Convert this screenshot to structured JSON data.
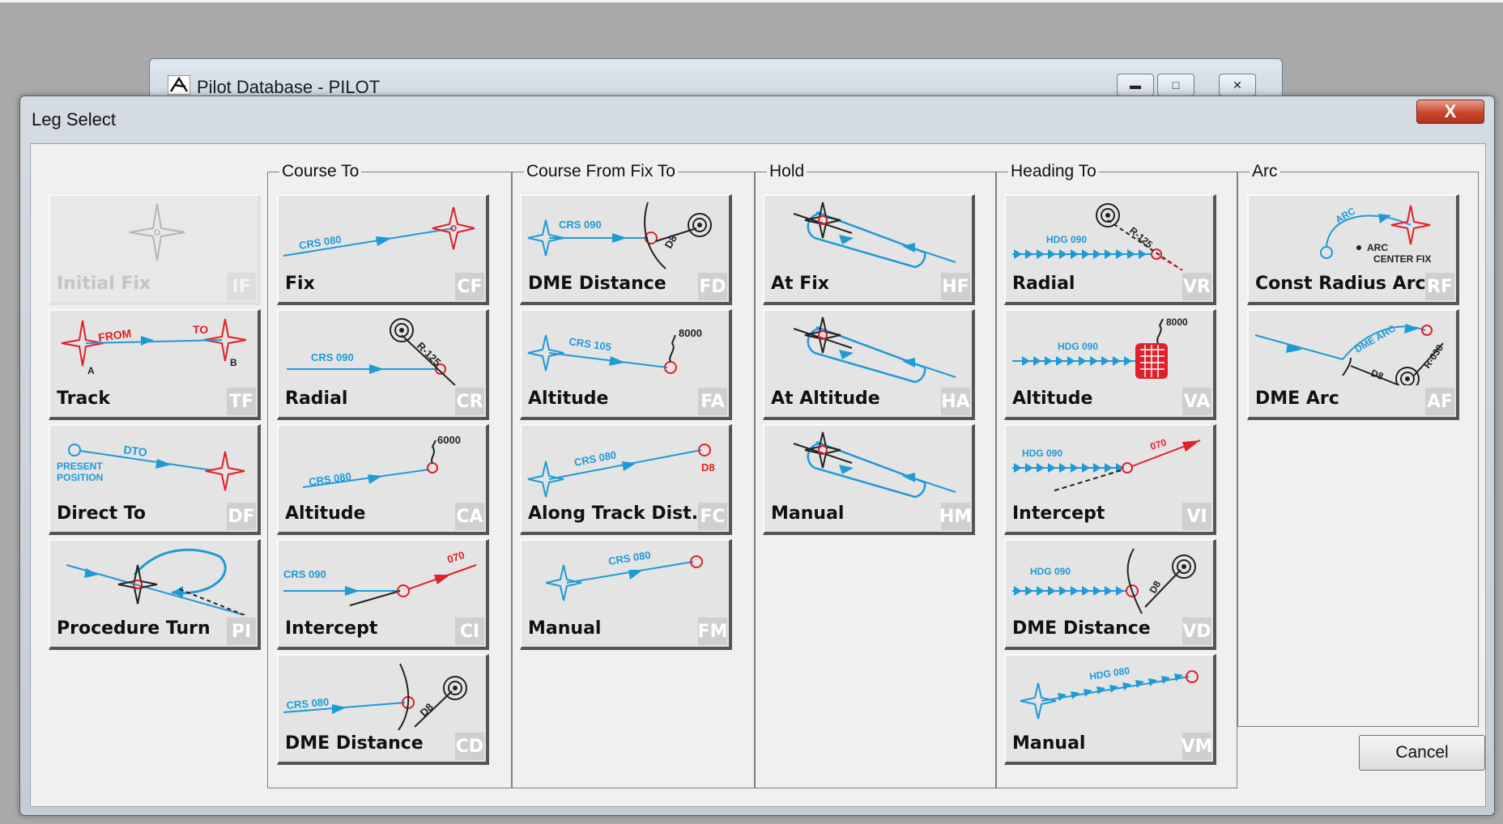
{
  "background_window": {
    "title": "Pilot Database - PILOT"
  },
  "dialog": {
    "title": "Leg Select",
    "close_label": "X",
    "cancel_label": "Cancel"
  },
  "groups": {
    "course_to": "Course To",
    "course_from_fix_to": "Course From Fix To",
    "hold": "Hold",
    "heading_to": "Heading To",
    "arc": "Arc"
  },
  "legs": {
    "if": {
      "label": "Initial Fix",
      "code": "IF",
      "enabled": false
    },
    "tf": {
      "label": "Track",
      "code": "TF",
      "diagram": {
        "from": "FROM",
        "to": "TO",
        "a": "A",
        "b": "B"
      }
    },
    "df": {
      "label": "Direct To",
      "code": "DF",
      "diagram": {
        "dto": "DTO",
        "present": "PRESENT",
        "position": "POSITION"
      }
    },
    "pi": {
      "label": "Procedure Turn",
      "code": "PI"
    },
    "cf": {
      "label": "Fix",
      "code": "CF",
      "diagram": {
        "crs": "CRS 080"
      }
    },
    "cr": {
      "label": "Radial",
      "code": "CR",
      "diagram": {
        "crs": "CRS 090",
        "radial": "R-125"
      }
    },
    "ca": {
      "label": "Altitude",
      "code": "CA",
      "diagram": {
        "crs": "CRS 080",
        "alt": "6000"
      }
    },
    "ci": {
      "label": "Intercept",
      "code": "CI",
      "diagram": {
        "crs": "CRS 090",
        "crs2": "070"
      }
    },
    "cd": {
      "label": "DME Distance",
      "code": "CD",
      "diagram": {
        "crs": "CRS 080",
        "dist": "D8"
      }
    },
    "fd": {
      "label": "DME Distance",
      "code": "FD",
      "diagram": {
        "crs": "CRS 090",
        "dist": "D8"
      }
    },
    "fa": {
      "label": "Altitude",
      "code": "FA",
      "diagram": {
        "crs": "CRS 105",
        "alt": "8000"
      }
    },
    "fc": {
      "label": "Along Track Dist.",
      "code": "FC",
      "diagram": {
        "crs": "CRS 080",
        "dist": "D8"
      }
    },
    "fm": {
      "label": "Manual",
      "code": "FM",
      "diagram": {
        "crs": "CRS 080"
      }
    },
    "hf": {
      "label": "At Fix",
      "code": "HF"
    },
    "ha": {
      "label": "At Altitude",
      "code": "HA"
    },
    "hm": {
      "label": "Manual",
      "code": "HM"
    },
    "vr": {
      "label": "Radial",
      "code": "VR",
      "diagram": {
        "hdg": "HDG 090",
        "radial": "R-125"
      }
    },
    "va": {
      "label": "Altitude",
      "code": "VA",
      "diagram": {
        "hdg": "HDG 090",
        "alt": "8000"
      }
    },
    "vi": {
      "label": "Intercept",
      "code": "VI",
      "diagram": {
        "hdg": "HDG 090",
        "crs2": "070"
      }
    },
    "vd": {
      "label": "DME Distance",
      "code": "VD",
      "diagram": {
        "hdg": "HDG 090",
        "dist": "D8"
      }
    },
    "vm": {
      "label": "Manual",
      "code": "VM",
      "diagram": {
        "hdg": "HDG 080"
      }
    },
    "rf": {
      "label": "Const Radius Arc",
      "code": "RF",
      "diagram": {
        "arc": "ARC",
        "center1": "ARC",
        "center2": "CENTER FIX"
      }
    },
    "af": {
      "label": "DME Arc",
      "code": "AF",
      "diagram": {
        "arc": "DME ARC",
        "dist": "D8",
        "radial": "R-030"
      }
    }
  },
  "colors": {
    "blue": "#1e9ad6",
    "red": "#e0202a",
    "dark": "#222222"
  },
  "icons": [
    "app-icon",
    "minimize-icon",
    "maximize-icon",
    "close-icon"
  ]
}
